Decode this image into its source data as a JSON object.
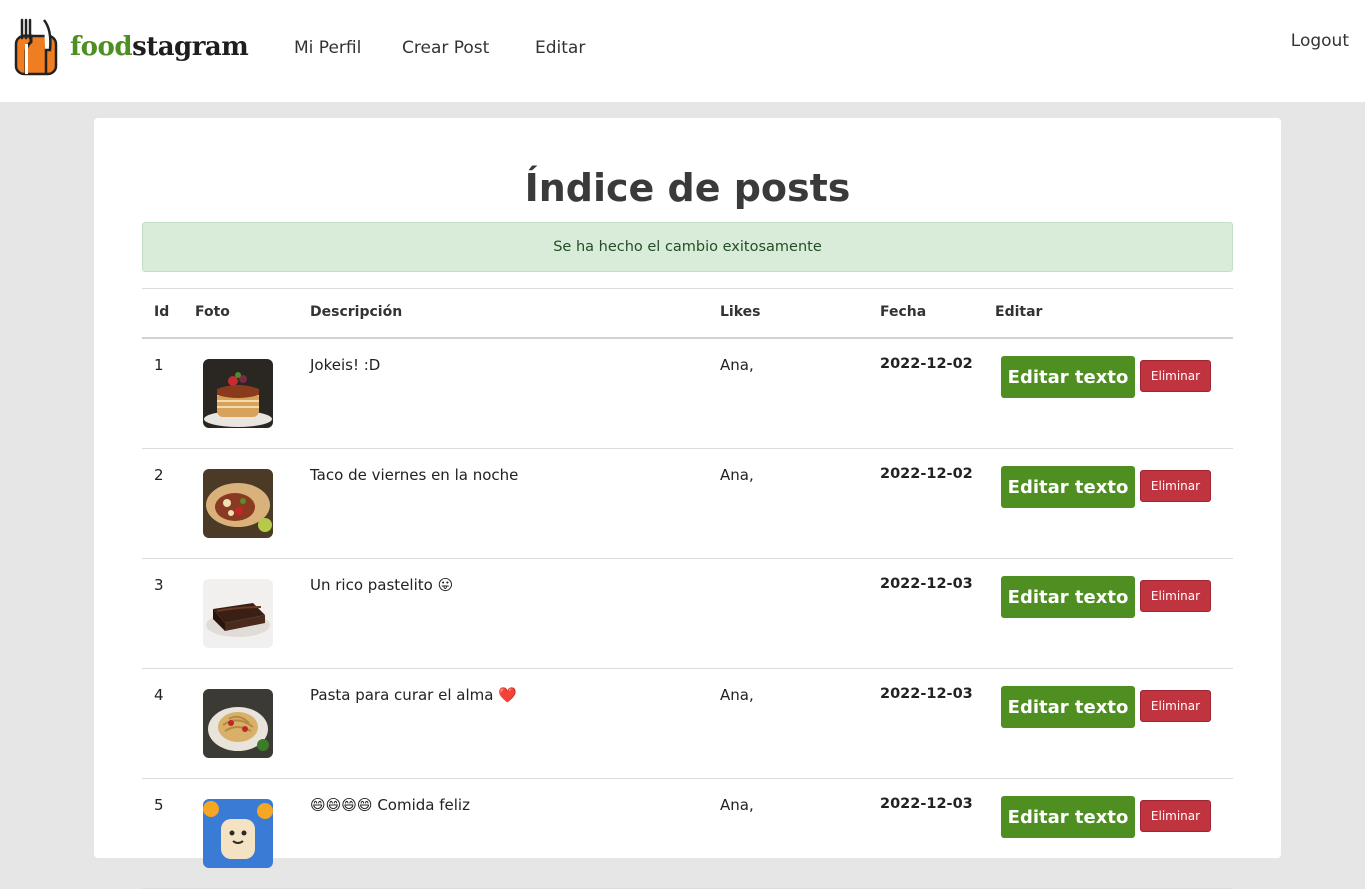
{
  "brand": {
    "part1": "food",
    "part2": "stagram"
  },
  "nav": {
    "links": [
      "Mi Perfil",
      "Crear Post",
      "Editar"
    ],
    "logout": "Logout"
  },
  "page": {
    "title": "Índice de posts",
    "alert": "Se ha hecho el cambio exitosamente"
  },
  "table": {
    "headers": [
      "Id",
      "Foto",
      "Descripción",
      "Likes",
      "Fecha",
      "Editar"
    ],
    "rows": [
      {
        "id": "1",
        "description": "Jokeis! :D",
        "likes": "Ana,",
        "date": "2022-12-02",
        "image": "pancakes"
      },
      {
        "id": "2",
        "description": "Taco de viernes en la noche",
        "likes": "Ana,",
        "date": "2022-12-02",
        "image": "burrito"
      },
      {
        "id": "3",
        "description": "Un rico pastelito 😛",
        "likes": "",
        "date": "2022-12-03",
        "image": "chocolate-cake"
      },
      {
        "id": "4",
        "description": "Pasta para curar el alma ❤️",
        "likes": "Ana,",
        "date": "2022-12-03",
        "image": "pasta"
      },
      {
        "id": "5",
        "description": "😄😄😄😄 Comida feliz",
        "likes": "Ana,",
        "date": "2022-12-03",
        "image": "toast"
      }
    ],
    "edit_label": "Editar texto",
    "delete_label": "Eliminar"
  },
  "colors": {
    "brand_green": "#4f8f22",
    "danger": "#c0343f",
    "alert_bg": "#d8ecd9",
    "logo_orange": "#ef7d22"
  }
}
